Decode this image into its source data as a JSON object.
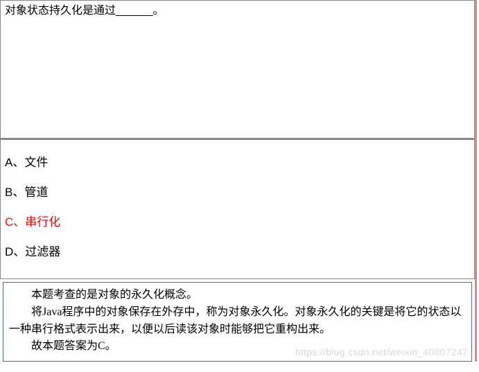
{
  "question": {
    "text": "对象状态持久化是通过______。"
  },
  "options": [
    {
      "label": "A、文件",
      "correct": false
    },
    {
      "label": "B、管道",
      "correct": false
    },
    {
      "label": "C、串行化",
      "correct": true
    },
    {
      "label": "D、过滤器",
      "correct": false
    }
  ],
  "explanation": {
    "p1": "本题考查的是对象的永久化概念。",
    "p2": "将Java程序中的对象保存在外存中，称为对象永久化。对象永久化的关键是将它的状态以一种串行格式表示出来，以便以后读该对象时能够把它重构出来。",
    "p3": "故本题答案为C。"
  },
  "watermark": "https://blog.csdn.net/weixin_40807247"
}
